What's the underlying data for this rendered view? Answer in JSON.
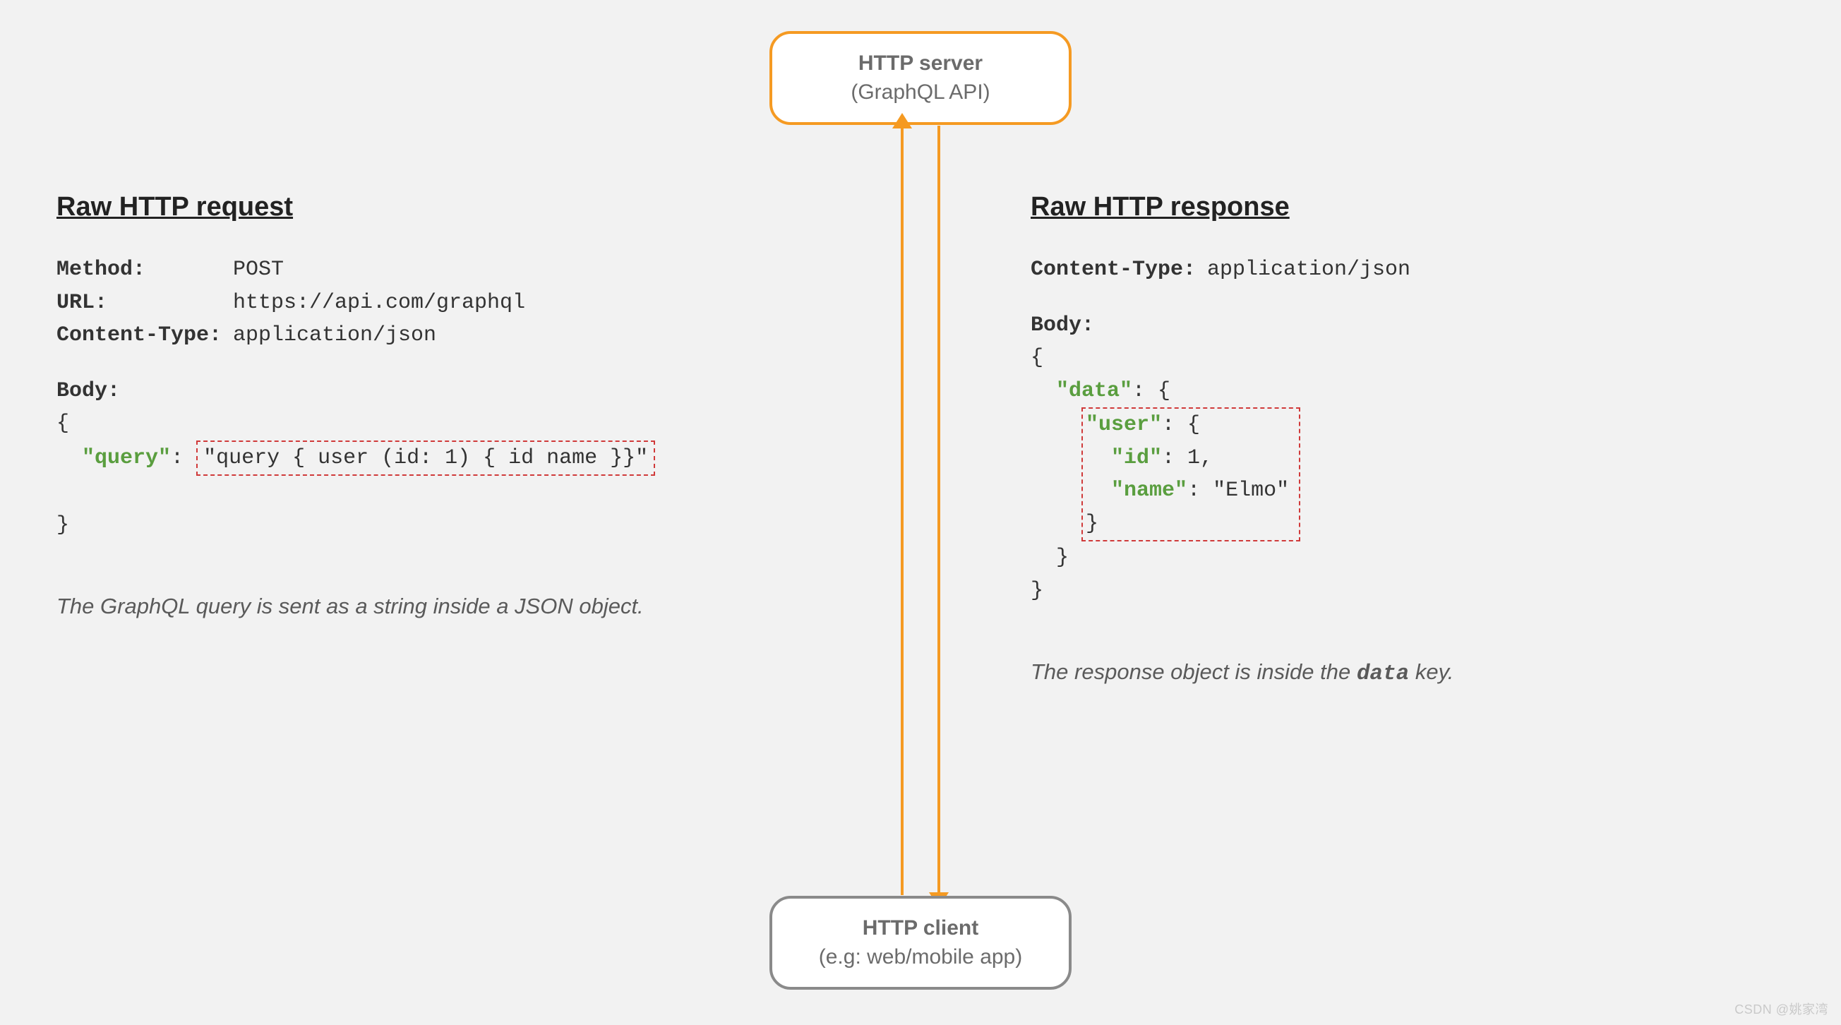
{
  "server": {
    "line1": "HTTP server",
    "line2": "(GraphQL API)"
  },
  "client": {
    "line1": "HTTP client",
    "line2": "(e.g: web/mobile app)"
  },
  "request": {
    "heading": "Raw HTTP request",
    "method_label": "Method:",
    "method_value": "POST",
    "url_label": "URL:",
    "url_value": "https://api.com/graphql",
    "ctype_label": "Content-Type:",
    "ctype_value": "application/json",
    "body_label": "Body:",
    "brace_open": "{",
    "query_key": "\"query\"",
    "query_colon": ": ",
    "query_value": "\"query { user (id: 1) { id name }}\"",
    "brace_close": "}",
    "footnote": "The GraphQL query is sent as a string inside a JSON object."
  },
  "response": {
    "heading": "Raw HTTP response",
    "ctype_label": "Content-Type:",
    "ctype_value": "application/json",
    "body_label": "Body:",
    "brace_open": "{",
    "data_key": "\"data\"",
    "data_open": ": {",
    "user_key": "\"user\"",
    "user_open": ": {",
    "id_key": "\"id\"",
    "id_val": ": 1,",
    "name_key": "\"name\"",
    "name_val": ": \"Elmo\"",
    "close_inner": "}",
    "close_data": "}",
    "close_outer": "}",
    "footnote_pre": "The response object is inside the ",
    "footnote_code": "data",
    "footnote_post": " key."
  },
  "watermark": "CSDN @姚家湾"
}
